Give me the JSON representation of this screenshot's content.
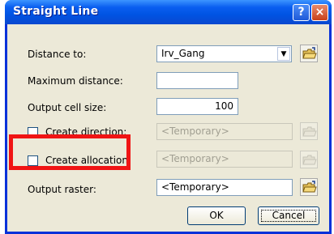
{
  "dialog": {
    "title": "Straight Line",
    "help_glyph": "?",
    "close_glyph": "×"
  },
  "fields": {
    "distance_to": {
      "label": "Distance to:",
      "value": "Irv_Gang",
      "arrow": "▼"
    },
    "maximum_distance": {
      "label": "Maximum distance:",
      "value": ""
    },
    "output_cell_size": {
      "label": "Output cell size:",
      "value": "100"
    },
    "create_direction": {
      "label": "Create direction:",
      "value": "<Temporary>",
      "checked": false,
      "enabled": false
    },
    "create_allocation": {
      "label": "Create allocation:",
      "value": "<Temporary>",
      "checked": false,
      "enabled": false
    },
    "output_raster": {
      "label": "Output raster:",
      "value": "<Temporary>"
    }
  },
  "buttons": {
    "ok": "OK",
    "cancel": "Cancel"
  },
  "annotation": {
    "color": "#f01414"
  }
}
